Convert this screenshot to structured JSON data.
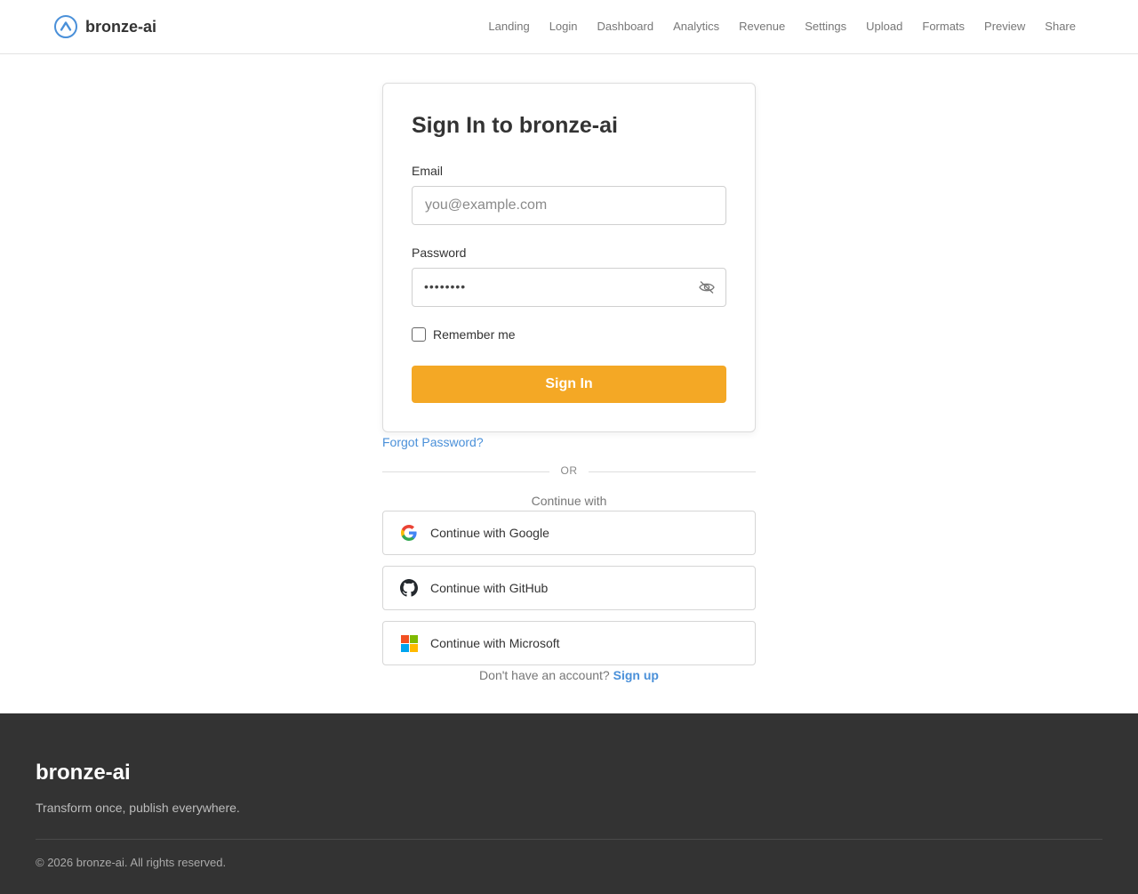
{
  "header": {
    "brand": "bronze-ai",
    "nav": [
      "Landing",
      "Login",
      "Dashboard",
      "Analytics",
      "Revenue",
      "Settings",
      "Upload",
      "Formats",
      "Preview",
      "Share"
    ]
  },
  "signin": {
    "title": "Sign In to bronze-ai",
    "email_label": "Email",
    "email_placeholder": "you@example.com",
    "password_label": "Password",
    "password_value": "••••••••",
    "remember_label": "Remember me",
    "button": "Sign In"
  },
  "forgot_password": "Forgot Password?",
  "divider": "OR",
  "continue_with": "Continue with",
  "oauth": {
    "google": "Continue with Google",
    "github": "Continue with GitHub",
    "microsoft": "Continue with Microsoft"
  },
  "signup": {
    "prompt": "Don't have an account?",
    "link": "Sign up"
  },
  "footer": {
    "brand": "bronze-ai",
    "tagline": "Transform once, publish everywhere.",
    "copyright": "© 2026 bronze-ai. All rights reserved."
  },
  "colors": {
    "accent": "#f4a825",
    "link": "#4a90d9",
    "footer_bg": "#333333"
  },
  "icons": {
    "brand": "chevron-up-circle-icon",
    "password_toggle": "eye-off-icon",
    "google": "google-icon",
    "github": "github-icon",
    "microsoft": "microsoft-icon"
  }
}
